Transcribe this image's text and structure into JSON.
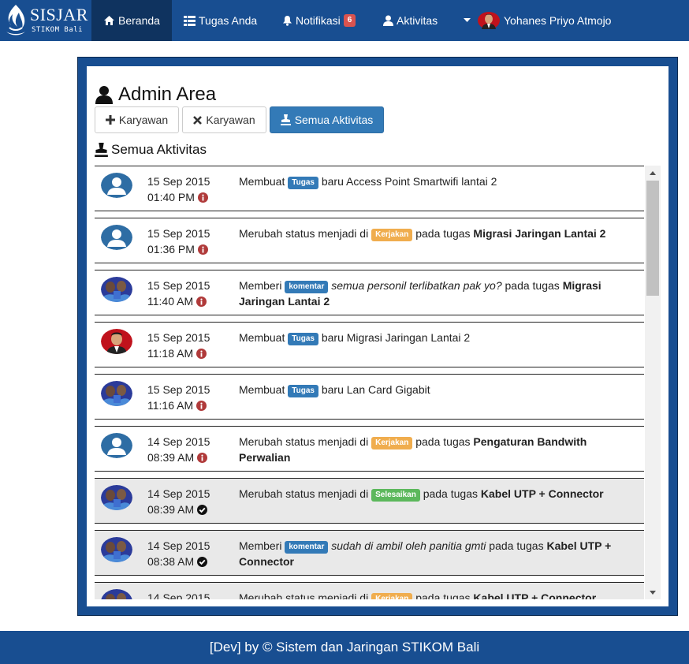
{
  "brand": {
    "name": "SISJAR",
    "sub": "STIKOM Bali"
  },
  "nav": {
    "home": {
      "label": "Beranda",
      "icon": "home-icon"
    },
    "tasks": {
      "label": "Tugas Anda",
      "icon": "table-icon"
    },
    "notifications": {
      "label": "Notifikasi",
      "count": "6",
      "icon": "bell-icon"
    },
    "activity": {
      "label": "Aktivitas",
      "icon": "user-icon"
    },
    "user": {
      "name": "Yohanes Priyo Atmojo",
      "icon": "caret-down-icon"
    }
  },
  "page": {
    "title": "Admin Area",
    "buttons": {
      "add": "Karyawan",
      "remove": "Karyawan",
      "all_activity": "Semua Aktivitas"
    },
    "section_title": "Semua Aktivitas"
  },
  "activities": [
    {
      "date": "15 Sep 2015",
      "time": "01:40 PM",
      "status_icon": "info-icon",
      "avatar": "default-avatar",
      "pre": "Membuat",
      "label": "Tugas",
      "label_color": "#337ab7",
      "italic": "",
      "mid": "baru Access Point Smartwifi lantai 2",
      "bold": ""
    },
    {
      "date": "15 Sep 2015",
      "time": "01:36 PM",
      "status_icon": "info-icon",
      "avatar": "default-avatar",
      "pre": "Merubah status menjadi di",
      "label": "Kerjakan",
      "label_color": "#f0ad4e",
      "italic": "",
      "mid": "pada tugas",
      "bold": "Migrasi Jaringan Lantai 2"
    },
    {
      "date": "15 Sep 2015",
      "time": "11:40 AM",
      "status_icon": "info-icon",
      "avatar": "group-photo-avatar",
      "pre": "Memberi",
      "label": "komentar",
      "label_color": "#337ab7",
      "italic": "semua personil terlibatkan pak yo?",
      "mid": "pada tugas",
      "bold": "Migrasi Jaringan Lantai 2"
    },
    {
      "date": "15 Sep 2015",
      "time": "11:18 AM",
      "status_icon": "info-icon",
      "avatar": "person-photo-avatar",
      "pre": "Membuat",
      "label": "Tugas",
      "label_color": "#337ab7",
      "italic": "",
      "mid": "baru Migrasi Jaringan Lantai 2",
      "bold": ""
    },
    {
      "date": "15 Sep 2015",
      "time": "11:16 AM",
      "status_icon": "info-icon",
      "avatar": "group-photo-avatar",
      "pre": "Membuat",
      "label": "Tugas",
      "label_color": "#337ab7",
      "italic": "",
      "mid": "baru Lan Card Gigabit",
      "bold": ""
    },
    {
      "date": "14 Sep 2015",
      "time": "08:39 AM",
      "status_icon": "info-icon",
      "avatar": "default-avatar",
      "pre": "Merubah status menjadi di",
      "label": "Kerjakan",
      "label_color": "#f0ad4e",
      "italic": "",
      "mid": "pada tugas",
      "bold": "Pengaturan Bandwith Perwalian"
    },
    {
      "date": "14 Sep 2015",
      "time": "08:39 AM",
      "status_icon": "check-circle-icon",
      "avatar": "group-photo-avatar",
      "pre": "Merubah status menjadi di",
      "label": "Selesaikan",
      "label_color": "#5cb85c",
      "italic": "",
      "mid": "pada tugas",
      "bold": "Kabel UTP + Connector"
    },
    {
      "date": "14 Sep 2015",
      "time": "08:38 AM",
      "status_icon": "check-circle-icon",
      "avatar": "group-photo-avatar",
      "pre": "Memberi",
      "label": "komentar",
      "label_color": "#337ab7",
      "italic": "sudah di ambil oleh panitia gmti",
      "mid": "pada tugas",
      "bold": "Kabel UTP + Connector"
    },
    {
      "date": "14 Sep 2015",
      "time": "",
      "status_icon": "",
      "avatar": "group-photo-avatar",
      "pre": "Merubah status menjadi di",
      "label": "Kerjakan",
      "label_color": "#f0ad4e",
      "italic": "",
      "mid": "pada tugas",
      "bold": "Kabel UTP + Connector"
    }
  ],
  "footer": {
    "text": "[Dev] by © Sistem dan Jaringan STIKOM Bali"
  },
  "colors": {
    "navbar": "#184e91",
    "navbar_active": "#0f335f",
    "primary": "#337ab7",
    "warning": "#f0ad4e",
    "success": "#5cb85c",
    "danger": "#d9534f",
    "info_icon": "#b03a3a"
  }
}
